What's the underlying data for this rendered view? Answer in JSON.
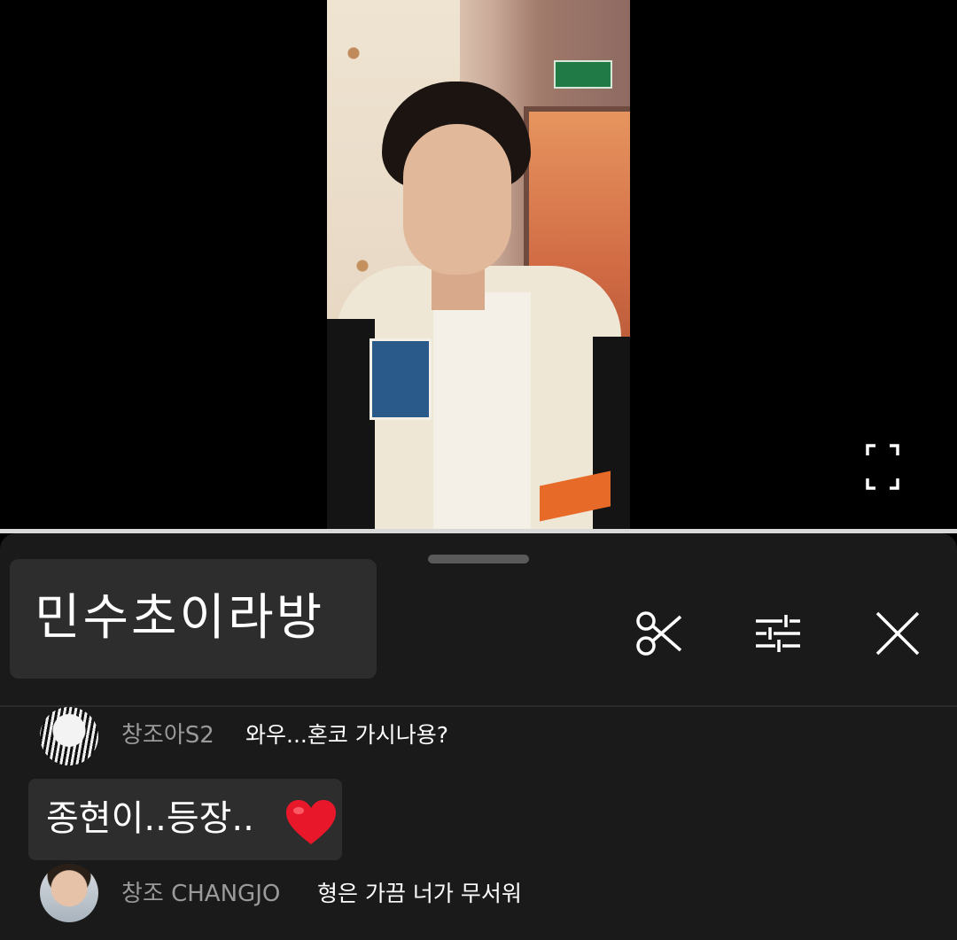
{
  "room": {
    "title": "민수초이라방"
  },
  "controls": {
    "fullscreen_icon": "fullscreen-icon",
    "clip_icon": "scissors-icon",
    "settings_icon": "sliders-icon",
    "close_icon": "close-icon"
  },
  "chat": {
    "messages": [
      {
        "user": "창조아S2",
        "text": "와우...혼코 가시나용?",
        "avatar": "manga-girl-avatar"
      },
      {
        "user": "창조 CHANGJO",
        "text": "형은 가끔 너가 무서워",
        "avatar": "man-portrait-avatar"
      }
    ],
    "sticker": {
      "text": "종현이..등장..",
      "emoji": "heart-icon",
      "emoji_color": "#e8182a"
    }
  },
  "colors": {
    "panel_bg": "#1a1a1a",
    "title_box_bg": "#2d2d2d",
    "username": "#9a9a9a",
    "message": "#ffffff"
  }
}
